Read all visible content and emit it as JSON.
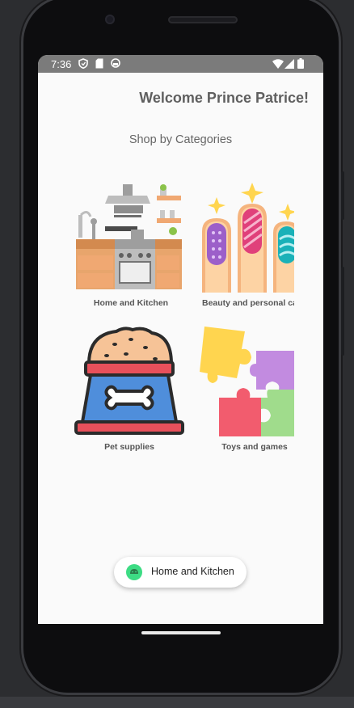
{
  "status_bar": {
    "time": "7:36",
    "left_icons": [
      "shield-icon",
      "sd-card-icon",
      "sync-icon"
    ],
    "right_icons": [
      "wifi-icon",
      "signal-icon",
      "battery-icon"
    ]
  },
  "header": {
    "welcome": "Welcome Prince Patrice!"
  },
  "section": {
    "title": "Shop by Categories"
  },
  "categories": [
    {
      "label": "Home and Kitchen",
      "icon": "kitchen-icon"
    },
    {
      "label": "Beauty and personal care",
      "icon": "nail-polish-icon"
    },
    {
      "label": "Pet supplies",
      "icon": "pet-food-icon"
    },
    {
      "label": "Toys and games",
      "icon": "puzzle-icon"
    }
  ],
  "toast": {
    "text": "Home and Kitchen",
    "icon": "android-icon"
  },
  "colors": {
    "status_bar": "#7b7b7b",
    "screen_bg": "#fafafa",
    "toast_logo": "#3ddc84"
  }
}
